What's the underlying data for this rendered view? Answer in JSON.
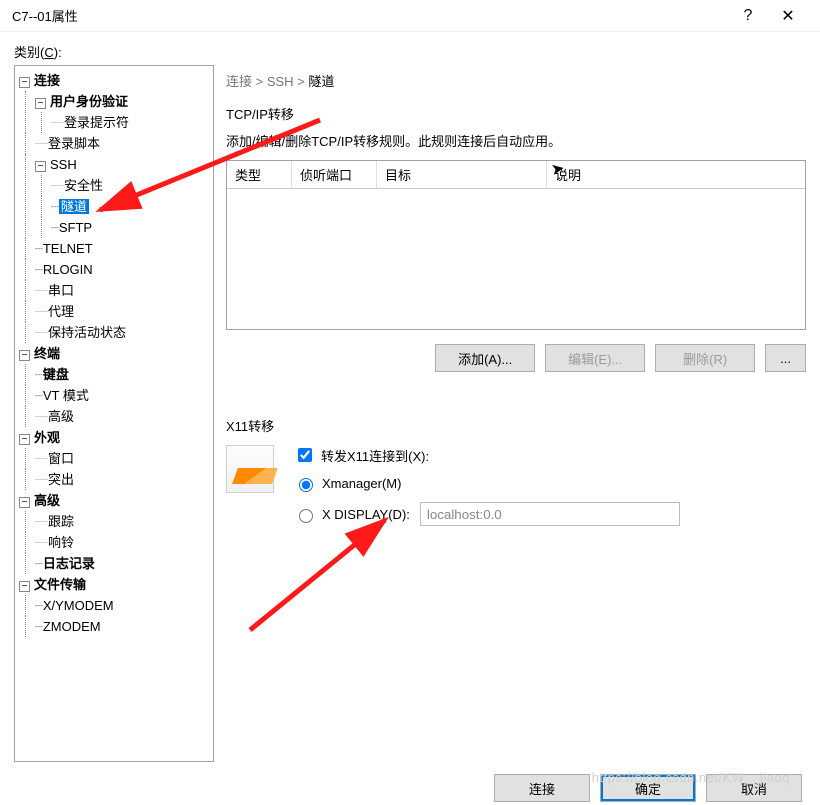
{
  "window": {
    "title": "C7--01属性",
    "help_symbol": "?",
    "close_symbol": "✕"
  },
  "category_label_pre": "类别(",
  "category_label_u": "C",
  "category_label_post": "):",
  "tree": {
    "connection": "连接",
    "auth": "用户身份验证",
    "login_prompt": "登录提示符",
    "login_script": "登录脚本",
    "ssh": "SSH",
    "security": "安全性",
    "tunnel": "隧道",
    "sftp": "SFTP",
    "telnet": "TELNET",
    "rlogin": "RLOGIN",
    "serial": "串口",
    "proxy": "代理",
    "keepalive": "保持活动状态",
    "terminal": "终端",
    "keyboard": "键盘",
    "vt_mode": "VT 模式",
    "adv1": "高级",
    "appearance": "外观",
    "window": "窗口",
    "highlight": "突出",
    "advanced": "高级",
    "trace": "跟踪",
    "bell": "响铃",
    "logging": "日志记录",
    "file_transfer": "文件传输",
    "xymodem": "X/YMODEM",
    "zmodem": "ZMODEM"
  },
  "breadcrumb": {
    "p1": "连接",
    "p2": "SSH",
    "p3": "隧道",
    "sep": " > "
  },
  "tcp_group": {
    "title": "TCP/IP转移",
    "desc": "添加/编辑/删除TCP/IP转移规则。此规则连接后自动应用。",
    "col_type": "类型",
    "col_port": "侦听端口",
    "col_target": "目标",
    "col_desc": "说明",
    "btn_add": "添加(A)...",
    "btn_edit": "编辑(E)...",
    "btn_del": "删除(R)",
    "btn_more": "..."
  },
  "x11": {
    "title": "X11转移",
    "forward_label": "转发X11连接到(X):",
    "xmanager": "Xmanager(M)",
    "xdisplay": "X DISPLAY(D):",
    "xdisplay_value": "localhost:0.0"
  },
  "footer": {
    "connect": "连接",
    "ok": "确定",
    "cancel": "取消"
  },
  "watermark": "https://blog.csdn.net/KW__jiaoq"
}
